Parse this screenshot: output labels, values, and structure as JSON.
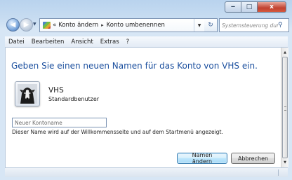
{
  "window": {
    "minimize_glyph": "‒",
    "maximize_glyph": "□",
    "close_glyph": "x"
  },
  "nav": {
    "back_icon": "arrow-left-icon",
    "forward_icon": "arrow-right-icon",
    "breadcrumb_prefix": "«",
    "breadcrumb": [
      "Konto ändern",
      "Konto umbenennen"
    ],
    "breadcrumb_separator": "▸",
    "refresh_glyph": "↻",
    "search_placeholder": "Systemsteuerung durchs...",
    "search_glyph": "⚲"
  },
  "menu": {
    "items": [
      "Datei",
      "Bearbeiten",
      "Ansicht",
      "Extras",
      "?"
    ]
  },
  "content": {
    "heading": "Geben Sie einen neuen Namen für das Konto von VHS ein.",
    "account": {
      "name": "VHS",
      "type": "Standardbenutzer",
      "avatar_icon": "dog-picture-icon"
    },
    "name_field": {
      "placeholder": "Neuer Kontoname",
      "value": ""
    },
    "hint": "Dieser Name wird auf der Willkommensseite und auf dem Startmenü angezeigt.",
    "buttons": {
      "rename": "Namen ändern",
      "cancel": "Abbrechen"
    }
  },
  "scrollbar": {
    "up_glyph": "▲",
    "down_glyph": "▼"
  },
  "colors": {
    "heading": "#1b4f9e",
    "frame": "#c7dcf1",
    "close_button": "#c14130"
  }
}
